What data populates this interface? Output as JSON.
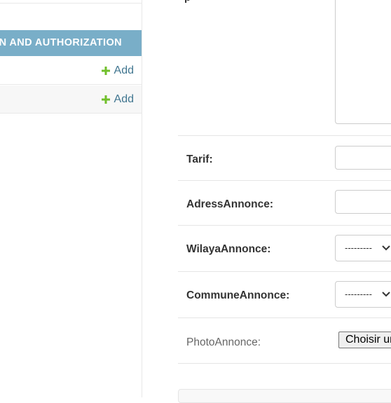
{
  "sidebar": {
    "section_caption": "N AND AUTHORIZATION",
    "rows": [
      {
        "add_label": "Add",
        "icon": "plus-icon"
      },
      {
        "add_label": "Add",
        "icon": "plus-icon"
      }
    ]
  },
  "form": {
    "textarea_label_fragment": "p",
    "fields": [
      {
        "label": "Tarif:",
        "type": "text",
        "value": ""
      },
      {
        "label": "AdressAnnonce:",
        "type": "text",
        "value": ""
      },
      {
        "label": "WilayaAnnonce:",
        "type": "select",
        "selected": "---------"
      },
      {
        "label": "CommuneAnnonce:",
        "type": "select",
        "selected": "---------"
      },
      {
        "label": "PhotoAnnonce:",
        "type": "file",
        "button_label": "Choisir un fichier"
      }
    ]
  },
  "colors": {
    "caption_bg": "#79aec8",
    "link": "#417690",
    "plus_icon": "#70bf2b"
  }
}
